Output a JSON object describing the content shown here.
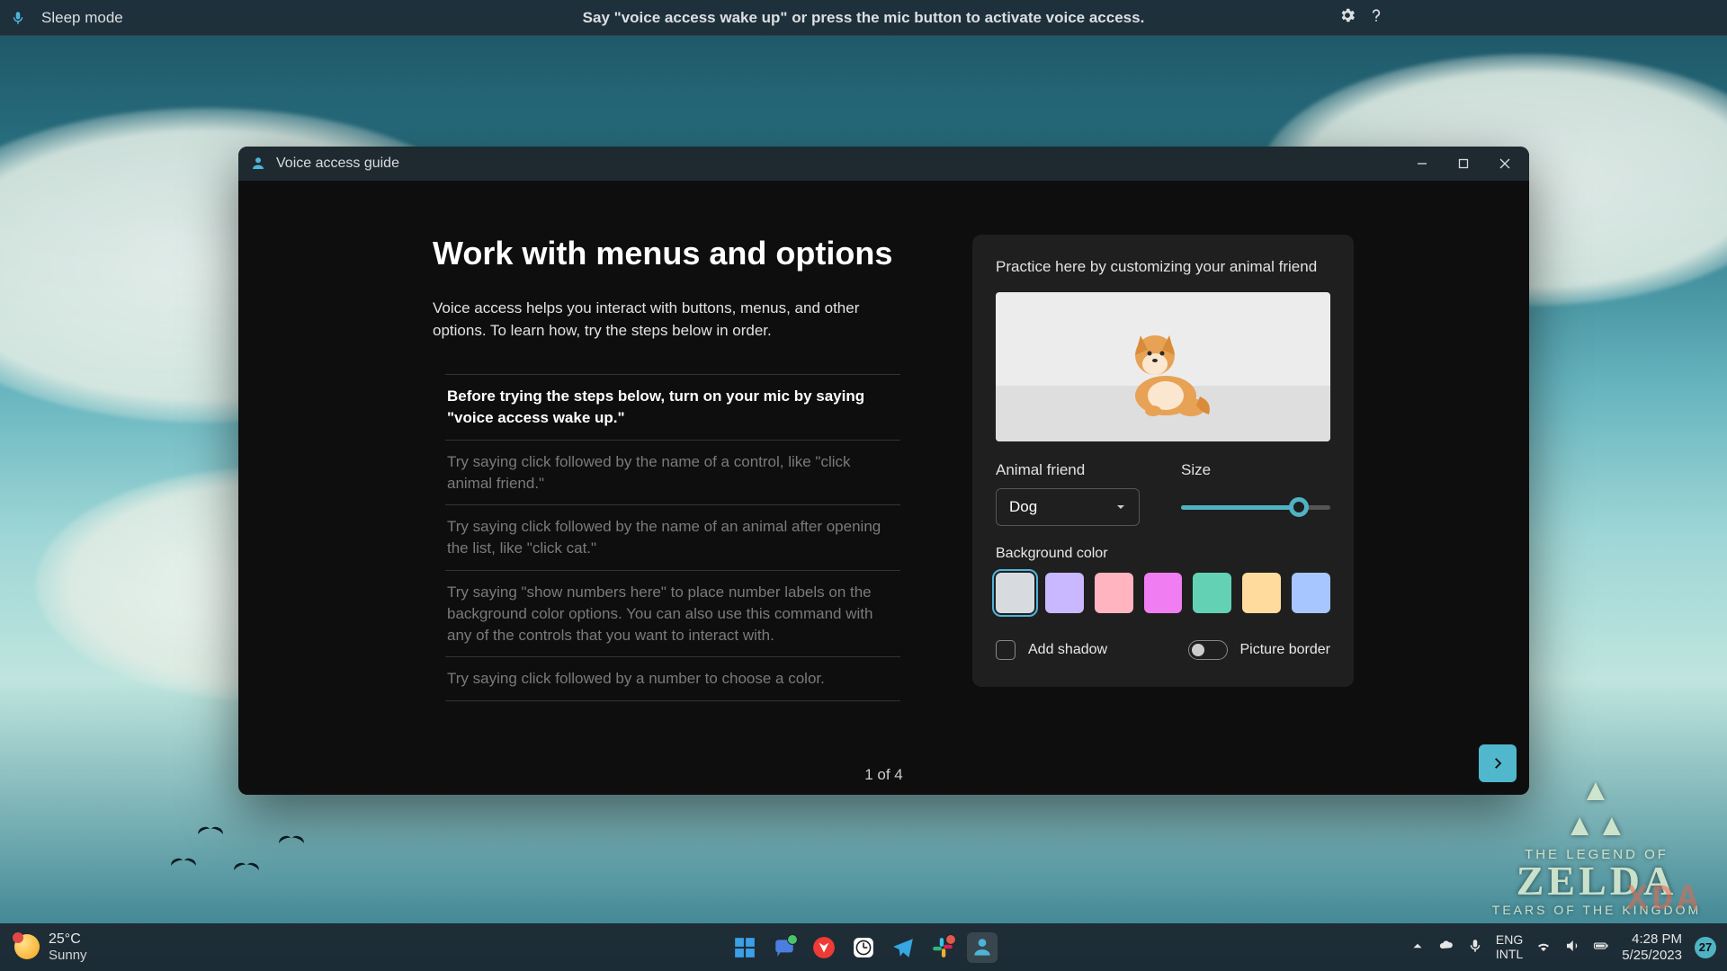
{
  "voicebar": {
    "mode": "Sleep mode",
    "hint": "Say \"voice access wake up\" or press the mic button to activate voice access."
  },
  "window": {
    "title": "Voice access guide",
    "heading": "Work with menus and options",
    "intro": "Voice access helps you interact with buttons, menus, and other options. To learn how, try the steps below in order.",
    "steps": [
      "Before trying the steps below, turn on your mic by saying \"voice access wake up.\"",
      "Try saying click followed by the name of a control, like \"click animal friend.\"",
      "Try saying click followed by the name of an animal after opening the list, like \"click cat.\"",
      "Try saying \"show numbers here\" to place number labels on the background color options. You can also use this command with any of the controls that you want to interact with.",
      "Try saying click followed by a number to choose a color."
    ],
    "pager": "1 of 4"
  },
  "practice": {
    "title": "Practice here by customizing your animal friend",
    "animal_label": "Animal friend",
    "animal_value": "Dog",
    "size_label": "Size",
    "size_percent": 79,
    "bg_label": "Background color",
    "colors": [
      "#d7dbe0",
      "#c9b8ff",
      "#ffb4bf",
      "#f17df2",
      "#63d2b4",
      "#ffdc9e",
      "#a7c5ff"
    ],
    "selected_color_index": 0,
    "checkbox_label": "Add shadow",
    "checkbox_checked": false,
    "toggle_label": "Picture border",
    "toggle_on": false
  },
  "taskbar": {
    "weather_temp": "25°C",
    "weather_cond": "Sunny",
    "lang1": "ENG",
    "lang2": "INTL",
    "time": "4:28 PM",
    "date": "5/25/2023",
    "notif_count": "27"
  },
  "zelda": {
    "line1": "THE LEGEND OF",
    "line2": "ZELDA",
    "line3": "TEARS OF THE KINGDOM"
  },
  "xda": "XDA"
}
